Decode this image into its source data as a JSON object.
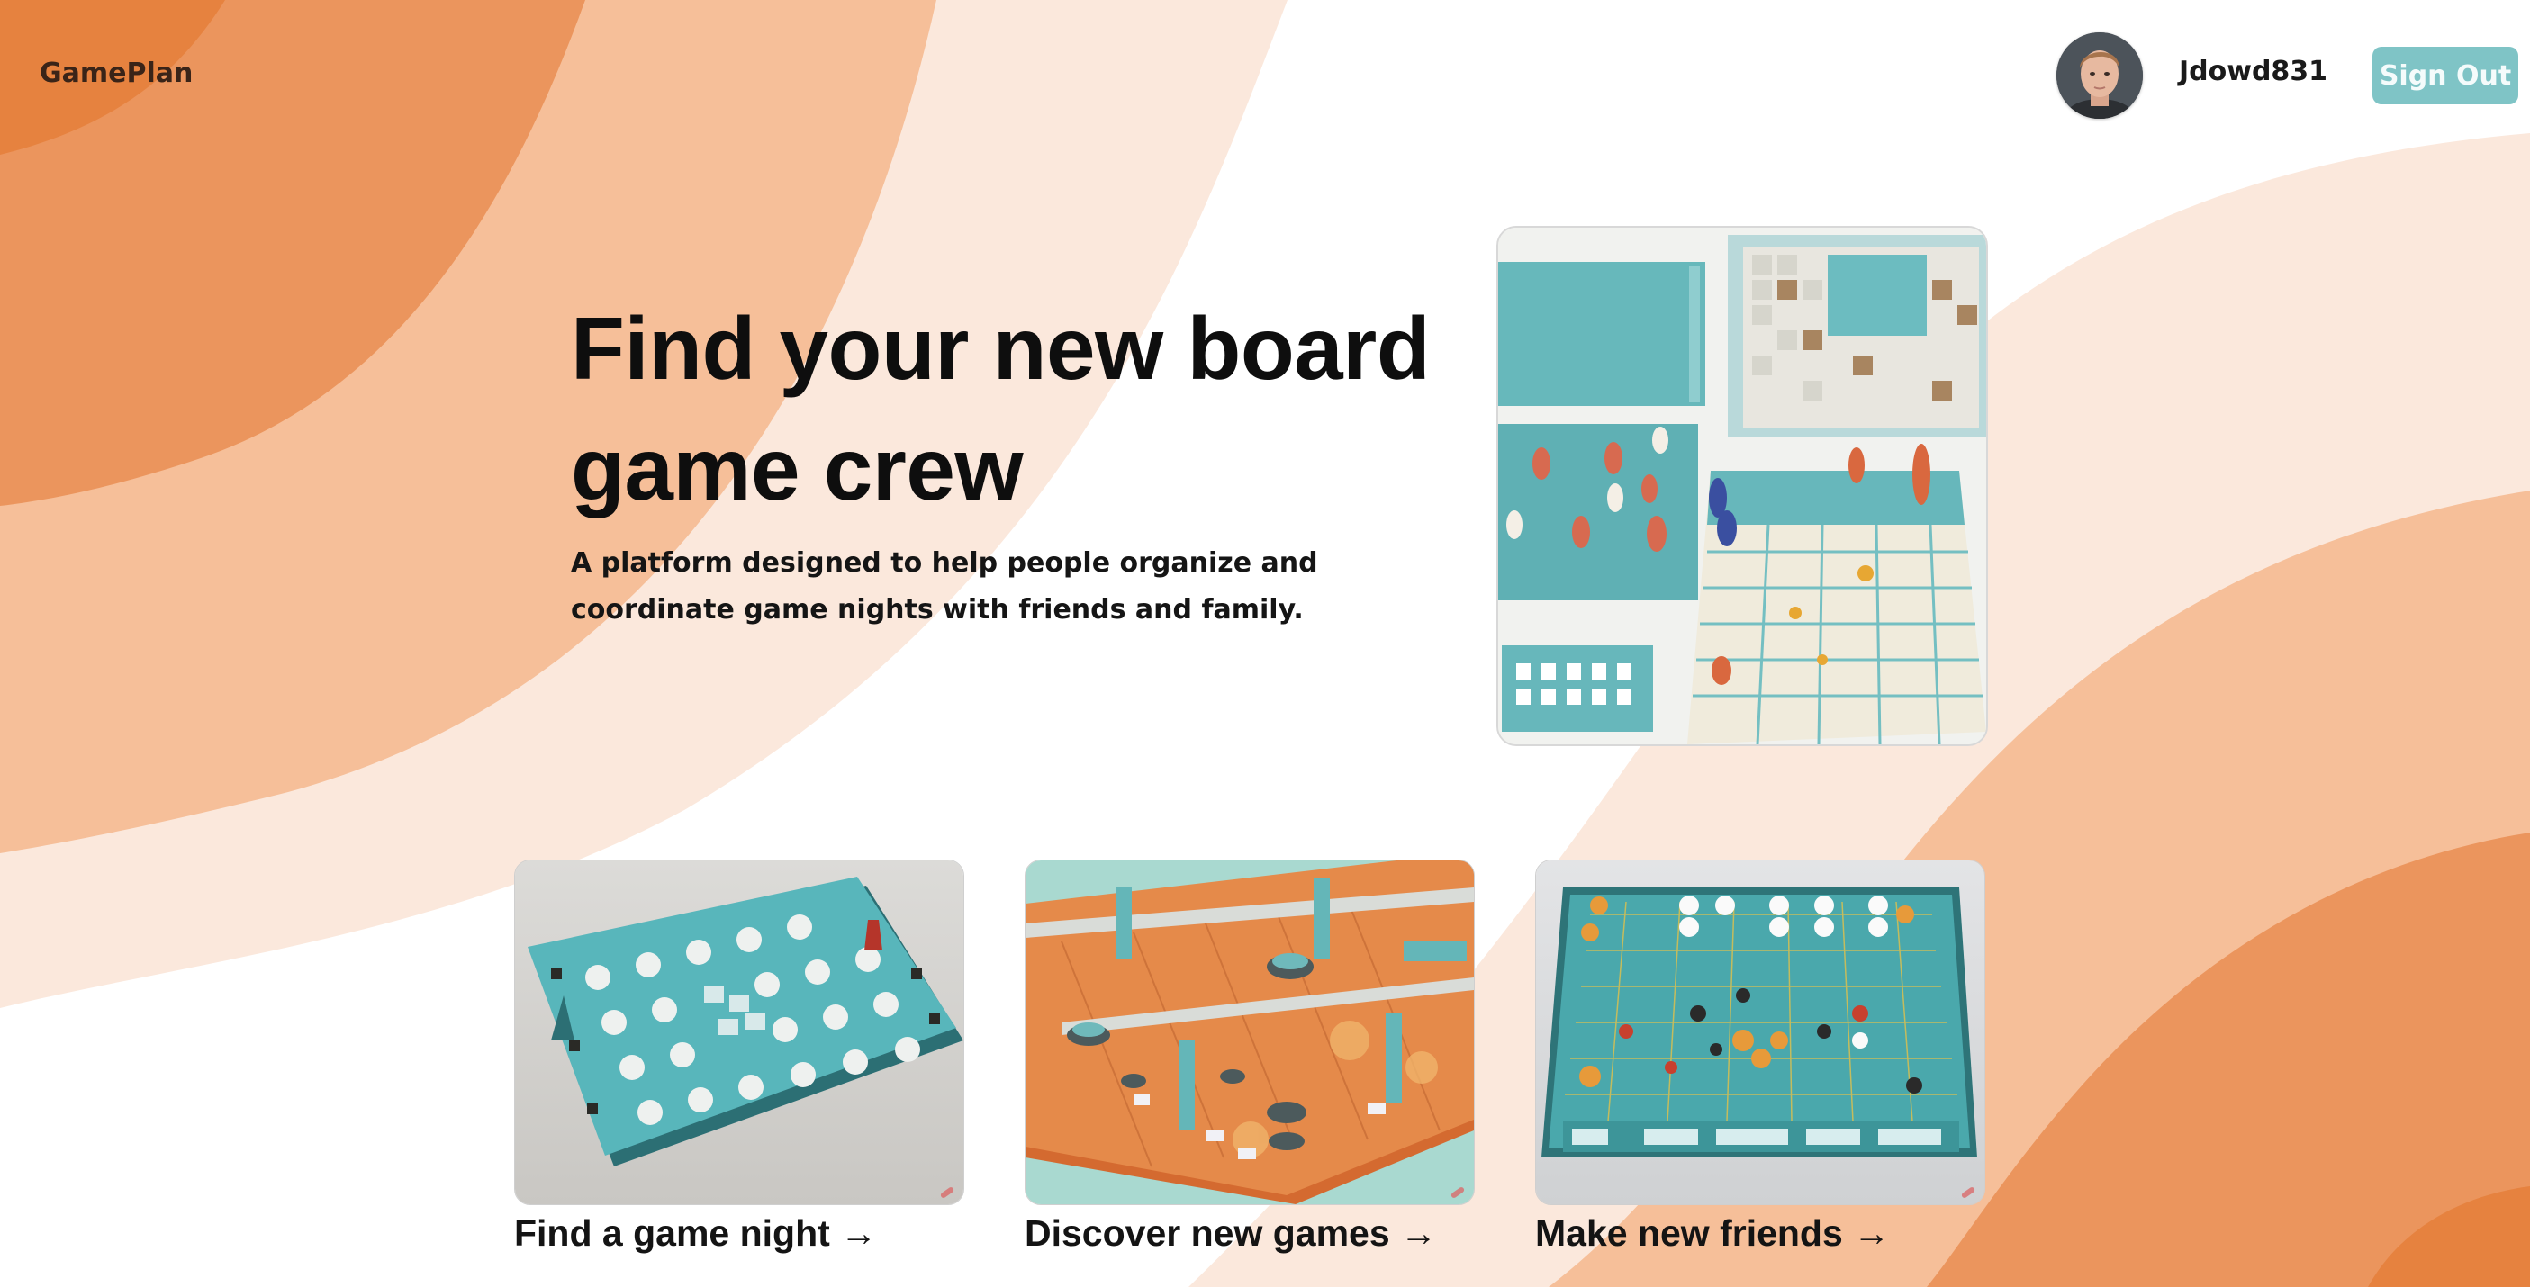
{
  "header": {
    "brand": "GamePlan",
    "username": "Jdowd831",
    "sign_out_label": "Sign Out"
  },
  "hero": {
    "title": "Find your new board game crew",
    "subtitle": "A platform designed to help people organize and coordinate game nights with friends and family."
  },
  "cards": [
    {
      "label": "Find a game night →"
    },
    {
      "label": "Discover new games →"
    },
    {
      "label": "Make new friends →"
    }
  ],
  "colors": {
    "orange_dark": "#e8854a",
    "orange_mid": "#f6bd97",
    "orange_light": "#fbe7dc",
    "teal_button": "#7fc4c6",
    "board_teal": "#4fa8ad",
    "board_orange": "#e0834a"
  }
}
